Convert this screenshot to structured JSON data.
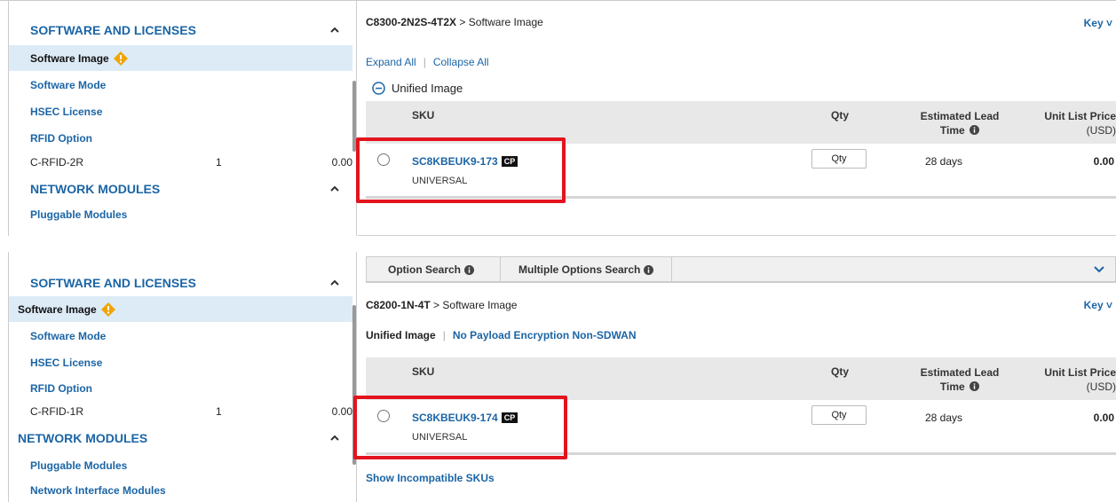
{
  "top": {
    "sidebar": {
      "section1_title": "SOFTWARE AND LICENSES",
      "items": [
        "Software Image",
        "Software Mode",
        "HSEC License",
        "RFID Option"
      ],
      "option_row": {
        "name": "C-RFID-2R",
        "qty": "1",
        "price": "0.00"
      },
      "section2_title": "NETWORK MODULES",
      "section2_items": [
        "Pluggable Modules"
      ]
    },
    "main": {
      "crumb_model": "C8300-2N2S-4T2X",
      "crumb_sep": ">",
      "crumb_page": "Software Image",
      "key": "Key",
      "expand_all": "Expand All",
      "collapse_all": "Collapse All",
      "group_label": "Unified Image",
      "columns": {
        "sku": "SKU",
        "qty": "Qty",
        "lead": "Estimated Lead Time",
        "price_l1": "Unit List Price",
        "price_l2": "(USD)"
      },
      "row": {
        "sku": "SC8KBEUK9-173",
        "badge": "CP",
        "sub": "UNIVERSAL",
        "qty_placeholder": "Qty",
        "lead": "28 days",
        "price": "0.00"
      }
    }
  },
  "bottom": {
    "sidebar": {
      "section1_title": "SOFTWARE AND LICENSES",
      "items": [
        "Software Image",
        "Software Mode",
        "HSEC License",
        "RFID Option"
      ],
      "option_row": {
        "name": "C-RFID-1R",
        "qty": "1",
        "price": "0.00"
      },
      "section2_title": "NETWORK MODULES",
      "section2_items": [
        "Pluggable Modules",
        "Network Interface Modules"
      ]
    },
    "main": {
      "tabs": [
        "Option Search",
        "Multiple Options Search"
      ],
      "crumb_model": "C8200-1N-4T",
      "crumb_sep": ">",
      "crumb_page": "Software Image",
      "key": "Key",
      "filter_active": "Unified Image",
      "filter_link": "No Payload Encryption Non-SDWAN",
      "columns": {
        "sku": "SKU",
        "qty": "Qty",
        "lead": "Estimated Lead Time",
        "price_l1": "Unit List Price",
        "price_l2": "(USD)"
      },
      "row": {
        "sku": "SC8KBEUK9-174",
        "badge": "CP",
        "sub": "UNIVERSAL",
        "qty_placeholder": "Qty",
        "lead": "28 days",
        "price": "0.00"
      },
      "show_incompatible": "Show Incompatible SKUs"
    }
  },
  "colors": {
    "link": "#1b65a6",
    "highlight": "#e3141e",
    "active_bg": "#ddebf7",
    "warning": "#f0a500"
  }
}
